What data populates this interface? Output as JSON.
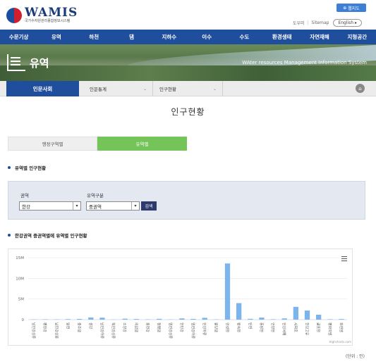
{
  "header": {
    "logo_text": "WAMIS",
    "logo_subtitle": "국가수자원관리종합정보시스템",
    "sitemap_button": "웹지도",
    "util_links": [
      "도우미",
      "Sitemap"
    ],
    "language": "English"
  },
  "gnb": [
    "수문기상",
    "유역",
    "하천",
    "댐",
    "지하수",
    "이수",
    "수도",
    "환경생태",
    "자연재해",
    "지형공간"
  ],
  "banner": {
    "title": "유역",
    "subtitle": "WAter resources Management Information System"
  },
  "lnb": {
    "current": "인문사회",
    "select1": "인문통계",
    "select2": "인구현황"
  },
  "page_title": "인구현황",
  "tabs": [
    {
      "label": "행정구역별",
      "active": false
    },
    {
      "label": "유역별",
      "active": true
    }
  ],
  "section1_title": "유역별 인구현황",
  "search": {
    "area_label": "권역",
    "area_value": "한강",
    "basin_label": "유역구분",
    "basin_value": "중권역",
    "button": "검색"
  },
  "section2_title": "한강권역 중권역별에 유역별 인구현황",
  "chart_data": {
    "type": "bar",
    "title": "",
    "xlabel": "",
    "ylabel": "",
    "ylim": [
      0,
      15000000
    ],
    "yticks": [
      "0",
      "5M",
      "10M",
      "15M"
    ],
    "ytick_values": [
      0,
      5000000,
      10000000,
      15000000
    ],
    "grid": true,
    "color": "#7cb5ec",
    "categories": [
      "남한강상류",
      "평창강",
      "남한강상류",
      "달천",
      "충주댐",
      "섬강",
      "남한강하류",
      "북한강상류",
      "소양강",
      "의암댐",
      "홍천강",
      "청평댐",
      "임진강상류",
      "한탄강",
      "임진강하류",
      "한강하류",
      "팔당댐",
      "안성천",
      "왕숙천",
      "탄천",
      "중랑천",
      "안양천",
      "한강서해",
      "시화호",
      "한강고유",
      "굴포천",
      "평화의댐",
      "화천댐"
    ],
    "values": [
      60000,
      90000,
      70000,
      130000,
      170000,
      520000,
      470000,
      40000,
      230000,
      150000,
      70000,
      200000,
      50000,
      300000,
      180000,
      440000,
      60000,
      13600000,
      4000000,
      200000,
      500000,
      100000,
      300000,
      3100000,
      2200000,
      1200000,
      100000,
      150000
    ],
    "credits": "Highcharts.com"
  },
  "unit_label": "(단위 : 인)"
}
